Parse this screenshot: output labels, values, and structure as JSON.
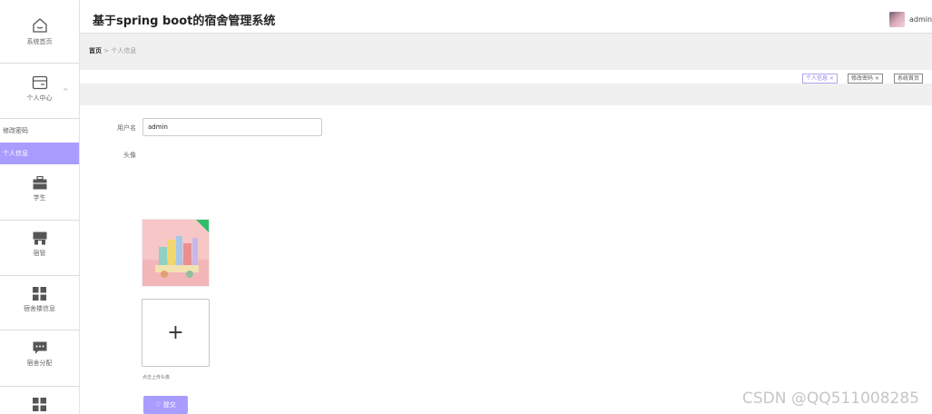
{
  "header": {
    "title": "基于spring boot的宿舍管理系统",
    "username": "admin"
  },
  "sidebar": {
    "home": "系统首页",
    "personal_center": "个人中心",
    "sub_items": [
      "修改密码",
      "个人信息"
    ],
    "items": [
      "学生",
      "宿管",
      "宿舍楼信息",
      "宿舍分配"
    ]
  },
  "breadcrumb": {
    "home": "首页",
    "separator": ">",
    "current": "个人信息"
  },
  "tabs": [
    {
      "label": "个人信息 ×",
      "active": true
    },
    {
      "label": "修改密码 ×",
      "active": false
    },
    {
      "label": "系统首页",
      "active": false
    }
  ],
  "form": {
    "username_label": "用户名",
    "username_value": "admin",
    "avatar_label": "头像",
    "upload_icon": "+",
    "upload_hint": "点击上传头像",
    "submit_label": "♡ 提交"
  },
  "watermark": "CSDN @QQ511008285",
  "colors": {
    "accent": "#a99cff",
    "corner_badge": "#2ebd6a"
  }
}
